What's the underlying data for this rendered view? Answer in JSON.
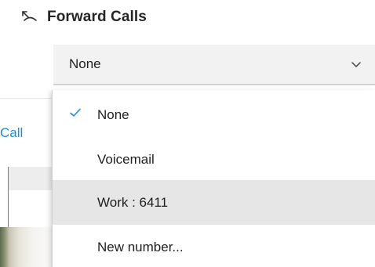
{
  "header": {
    "title": "Forward Calls",
    "icon": "call-forward-icon"
  },
  "select": {
    "selected_value": "None",
    "chevron_icon": "chevron-down-icon"
  },
  "background": {
    "call_label": "Call"
  },
  "dropdown": {
    "options": [
      {
        "label": "None",
        "selected": true,
        "highlighted": false
      },
      {
        "label": "Voicemail",
        "selected": false,
        "highlighted": false
      },
      {
        "label": "Work : 6411",
        "selected": false,
        "highlighted": true
      },
      {
        "label": "New number...",
        "selected": false,
        "highlighted": false
      }
    ]
  },
  "colors": {
    "accent": "#1a8fd6",
    "highlight_row": "#e6e6e6",
    "select_background": "#f2f2f2"
  }
}
